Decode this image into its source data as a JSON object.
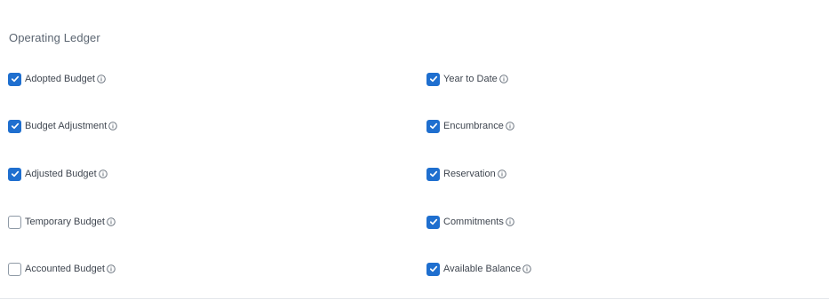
{
  "section": {
    "title": "Operating Ledger"
  },
  "left_options": [
    {
      "label": "Adopted Budget",
      "checked": true
    },
    {
      "label": "Budget Adjustment",
      "checked": true
    },
    {
      "label": "Adjusted Budget",
      "checked": true
    },
    {
      "label": "Temporary Budget",
      "checked": false
    },
    {
      "label": "Accounted Budget",
      "checked": false
    }
  ],
  "right_options": [
    {
      "label": "Year to Date",
      "checked": true
    },
    {
      "label": "Encumbrance",
      "checked": true
    },
    {
      "label": "Reservation",
      "checked": true
    },
    {
      "label": "Commitments",
      "checked": true
    },
    {
      "label": "Available Balance",
      "checked": true
    }
  ],
  "icons": {
    "checkbox_check": "check-icon",
    "info": "info-circle-icon"
  },
  "colors": {
    "checked_fill": "#1f6fcf",
    "unchecked_border": "#8f9aa6",
    "label_text": "#3f4650",
    "title_text": "#5b6571"
  }
}
